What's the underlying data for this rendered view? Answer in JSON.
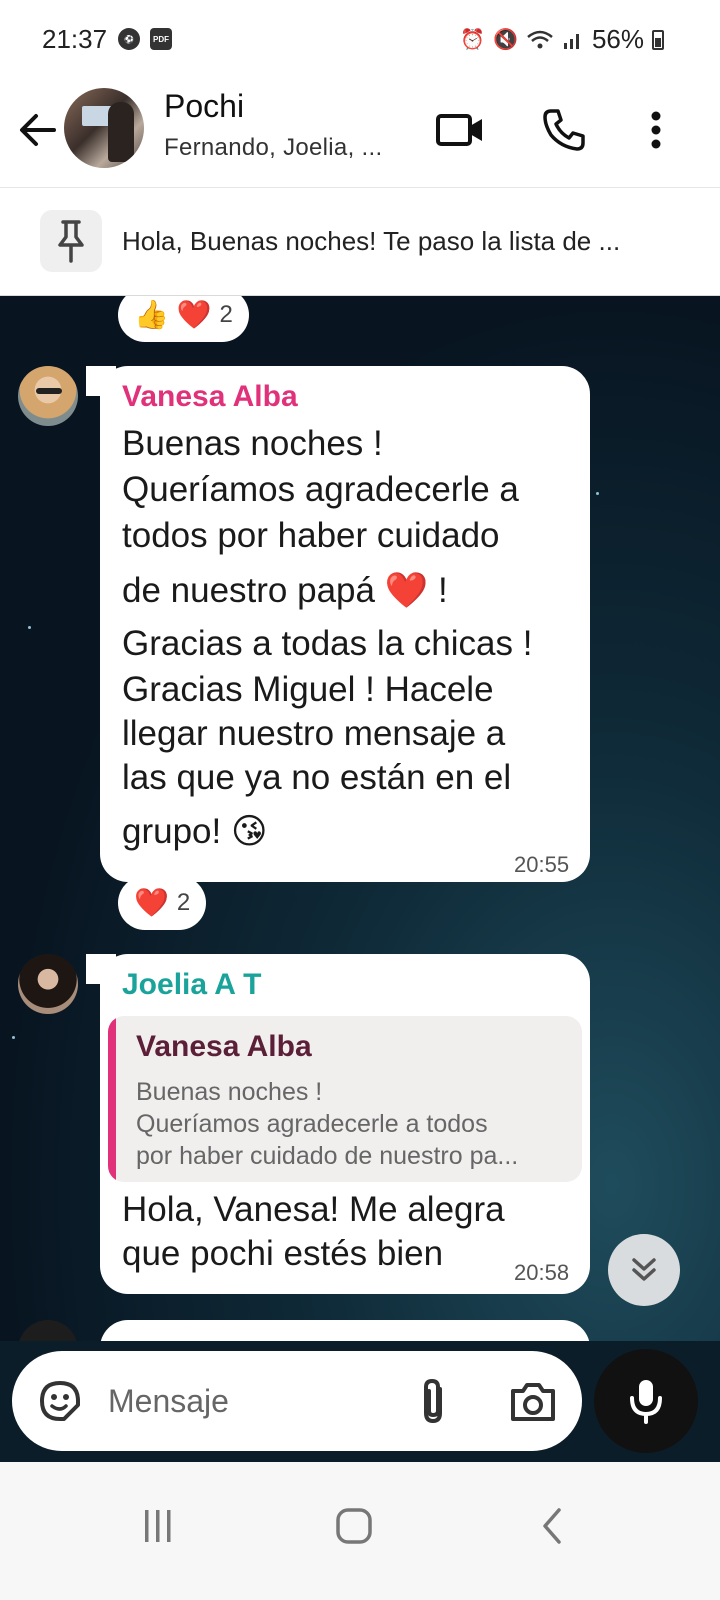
{
  "status_bar": {
    "time": "21:37",
    "battery": "56%",
    "left_icons": [
      "ball-icon",
      "pdf-icon"
    ],
    "right_icons": [
      "alarm-icon",
      "mute-icon",
      "wifi-icon",
      "signal-icon",
      "battery-icon"
    ]
  },
  "header": {
    "title": "Pochi",
    "subtitle": "Fernando, Joelia, ..."
  },
  "pinned": {
    "text": "Hola, Buenas noches! Te paso la lista de ..."
  },
  "messages": {
    "reaction_top": {
      "emojis": "👍 ❤️",
      "count": "2"
    },
    "vanesa": {
      "sender": "Vanesa Alba",
      "lines": [
        "Buenas noches !",
        "Queríamos  agradecerle a",
        "todos por haber cuidado",
        "de nuestro papá  ❤️ !",
        "Gracias a todas la chicas !",
        "Gracias Miguel ! Hacele",
        "llegar nuestro mensaje a",
        "las que ya no están en el",
        "grupo! 😘"
      ],
      "time": "20:55",
      "reaction": {
        "emojis": "❤️",
        "count": "2"
      }
    },
    "joelia": {
      "sender": "Joelia A T",
      "quote": {
        "sender": "Vanesa Alba",
        "lines": [
          "Buenas noches !",
          "Queríamos  agradecerle a todos",
          "por haber cuidado de nuestro pa..."
        ]
      },
      "lines": [
        "Hola, Vanesa! Me alegra",
        "que pochi estés bien"
      ],
      "time": "20:58"
    }
  },
  "input": {
    "placeholder": "Mensaje"
  },
  "colors": {
    "vanesa_name": "#e0317a",
    "joelia_name": "#1aa39a",
    "quote_bar": "#e0317a",
    "quote_name": "#5b2038"
  }
}
